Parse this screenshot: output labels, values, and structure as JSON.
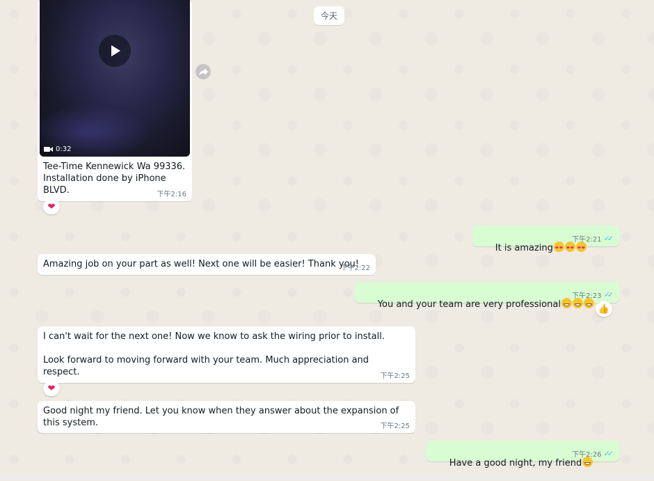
{
  "date_chip": "今天",
  "messages": [
    {
      "id": "m1",
      "direction": "in",
      "type": "video",
      "video_duration": "0:32",
      "text": "Tee-Time Kennewick Wa 99336.\nInstallation done by iPhone BLVD.",
      "time": "下午2:16",
      "reaction": "heart"
    },
    {
      "id": "m2",
      "direction": "out",
      "text": "It is amazing",
      "emoji": [
        "heart-eyes",
        "heart-eyes",
        "heart-eyes"
      ],
      "time": "下午2:21",
      "status": "read"
    },
    {
      "id": "m3",
      "direction": "in",
      "text": "Amazing job on your part as well! Next one will be easier! Thank you!",
      "time": "下午2:22"
    },
    {
      "id": "m4",
      "direction": "out",
      "text": "You and your team are very professional",
      "emoji": [
        "grin",
        "grin",
        "grin"
      ],
      "time": "下午2:23",
      "status": "read",
      "reaction": "thumbs-up"
    },
    {
      "id": "m5",
      "direction": "in",
      "text": "I can't wait for the next one! Now we know to ask the wiring prior to install.\n\nLook forward to moving forward with your team. Much appreciation and respect.",
      "time": "下午2:25",
      "reaction": "heart"
    },
    {
      "id": "m6",
      "direction": "in",
      "text": "Good night my friend. Let you know when they answer about the expansion of this system.",
      "time": "下午2:25"
    },
    {
      "id": "m7",
      "direction": "out",
      "text": "Have a good night, my friend",
      "emoji": [
        "grin"
      ],
      "time": "下午2:26",
      "status": "read"
    }
  ],
  "colors": {
    "incoming": "#ffffff",
    "outgoing": "#d9fdd3",
    "read_ticks": "#53bdeb",
    "background": "#efeae2"
  }
}
